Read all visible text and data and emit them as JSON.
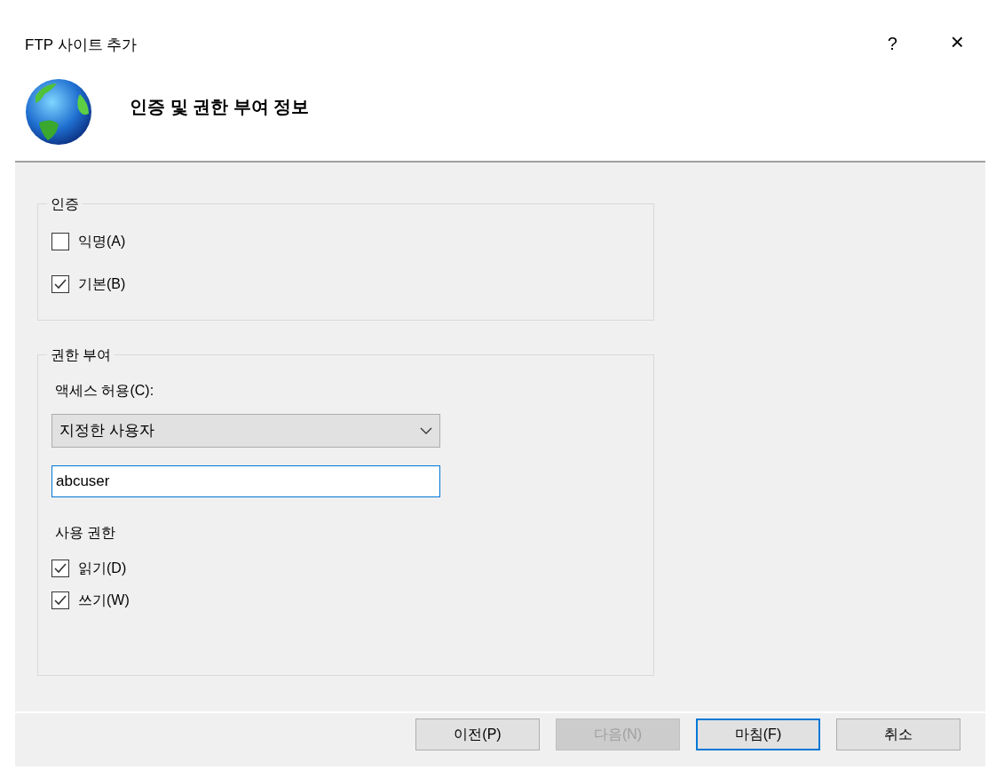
{
  "window": {
    "title": "FTP 사이트 추가",
    "help": "?",
    "close": "×"
  },
  "header": {
    "title": "인증 및 권한 부여 정보"
  },
  "authentication": {
    "legend": "인증",
    "options": [
      {
        "label": "익명(A)",
        "checked": false
      },
      {
        "label": "기본(B)",
        "checked": true
      }
    ]
  },
  "authorization": {
    "legend": "권한 부여",
    "access_label": "액세스 허용(C):",
    "access_value": "지정한 사용자",
    "user_value": "abcuser",
    "permissions_label": "사용 권한",
    "permissions": [
      {
        "label": "읽기(D)",
        "checked": true
      },
      {
        "label": "쓰기(W)",
        "checked": true
      }
    ]
  },
  "buttons": [
    {
      "label": "이전(P)",
      "disabled": false,
      "focused": false
    },
    {
      "label": "다음(N)",
      "disabled": true,
      "focused": false
    },
    {
      "label": "마침(F)",
      "disabled": false,
      "focused": true
    },
    {
      "label": "취소",
      "disabled": false,
      "focused": false
    }
  ]
}
